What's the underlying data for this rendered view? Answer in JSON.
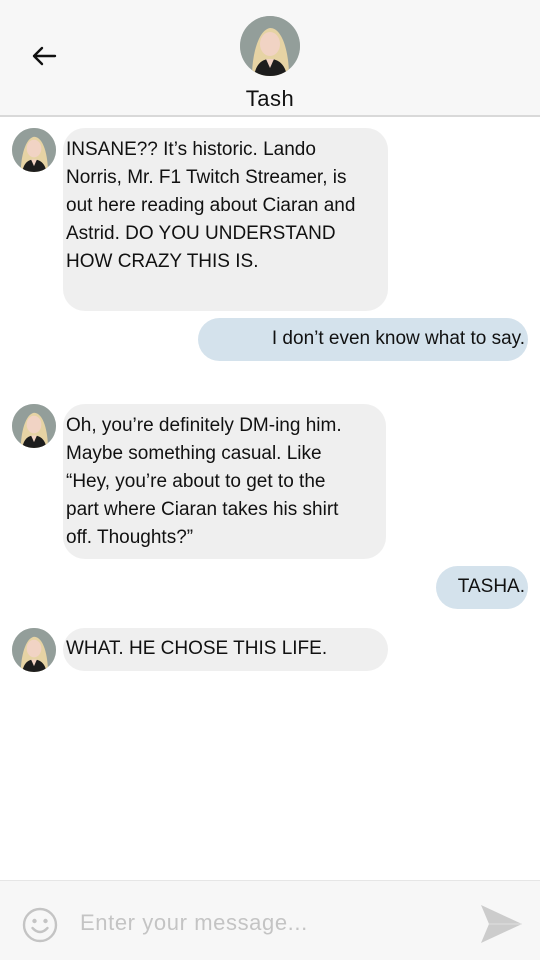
{
  "header": {
    "back_icon": "arrow-left-icon",
    "contact_name": "Tash",
    "avatar": "contact-avatar"
  },
  "messages": [
    {
      "sender": "contact",
      "lines": [
        "INSANE?? It’s historic. Lando",
        "Norris, Mr. F1 Twitch Streamer, is",
        "out here reading about Ciaran and",
        "Astrid. DO YOU UNDERSTAND",
        "HOW CRAZY THIS IS."
      ]
    },
    {
      "sender": "me",
      "text": "I don’t even know what to say."
    },
    {
      "sender": "contact",
      "lines": [
        "Oh, you’re definitely DM-ing him.",
        "Maybe something casual. Like",
        "“Hey, you’re about to get to the",
        "part where Ciaran takes his shirt",
        "off. Thoughts?”"
      ]
    },
    {
      "sender": "me",
      "text": "TASHA."
    },
    {
      "sender": "contact",
      "lines": [
        "WHAT. HE CHOSE THIS LIFE."
      ]
    }
  ],
  "composer": {
    "emoji_icon": "smiley-icon",
    "placeholder": "Enter your message...",
    "value": "",
    "send_icon": "send-icon"
  },
  "colors": {
    "incoming_bubble": "#efefef",
    "outgoing_bubble": "#d4e2ec",
    "header_bg": "#f7f7f7"
  }
}
